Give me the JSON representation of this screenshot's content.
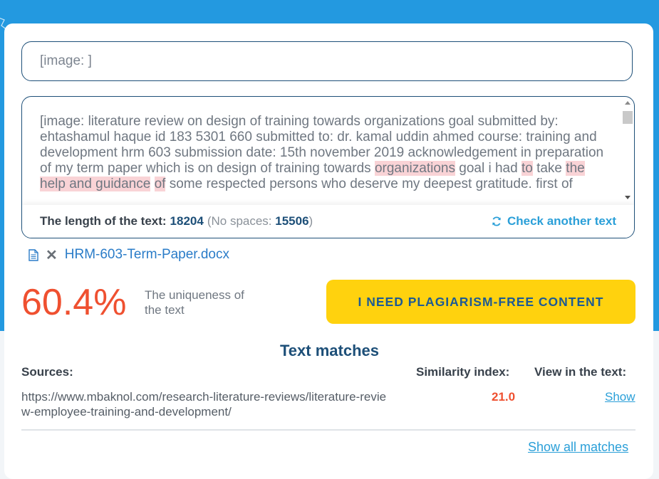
{
  "title_field": {
    "value": "[image: ]"
  },
  "text_content": {
    "segments": [
      {
        "text": "[image: literature review on design of training towards organizations goal submitted by: ehtashamul haque id 183 5301 660 submitted to: dr. kamal uddin ahmed course: training and development hrm 603 submission date: 15th november 2019 acknowledgement in preparation of my term paper which is on design of training towards ",
        "hl": false
      },
      {
        "text": "organizations",
        "hl": true
      },
      {
        "text": " goal i had ",
        "hl": false
      },
      {
        "text": "to",
        "hl": true
      },
      {
        "text": " take ",
        "hl": false
      },
      {
        "text": "the help and guidance",
        "hl": true
      },
      {
        "text": " ",
        "hl": false
      },
      {
        "text": "of",
        "hl": true
      },
      {
        "text": " some respected persons who deserve my deepest gratitude. first of",
        "hl": false
      }
    ]
  },
  "length_bar": {
    "label": "The length of the text:",
    "value": "18204",
    "nospace_open": "(No spaces:",
    "nospace_value": "15506",
    "nospace_close": ")",
    "check_another_label": "Check another text"
  },
  "file": {
    "name": "HRM-603-Term-Paper.docx",
    "remove_symbol": "✕"
  },
  "result": {
    "uniqueness": "60.4%",
    "uniqueness_label": "The uniqueness of the text",
    "cta_label": "I NEED PLAGIARISM-FREE CONTENT"
  },
  "matches": {
    "title": "Text matches",
    "col_sources": "Sources:",
    "col_similarity": "Similarity index:",
    "col_view": "View in the text:",
    "rows": [
      {
        "url": "https://www.mbaknol.com/research-literature-reviews/literature-review-employee-training-and-development/",
        "similarity": "21.0",
        "view_label": "Show"
      }
    ],
    "show_all_label": "Show all matches"
  },
  "colors": {
    "accent_blue": "#2399e0",
    "brand_dark": "#1d4f78",
    "uniqueness_red": "#ef5030",
    "cta_yellow": "#ffd20e",
    "highlight": "#f9d3d6"
  }
}
